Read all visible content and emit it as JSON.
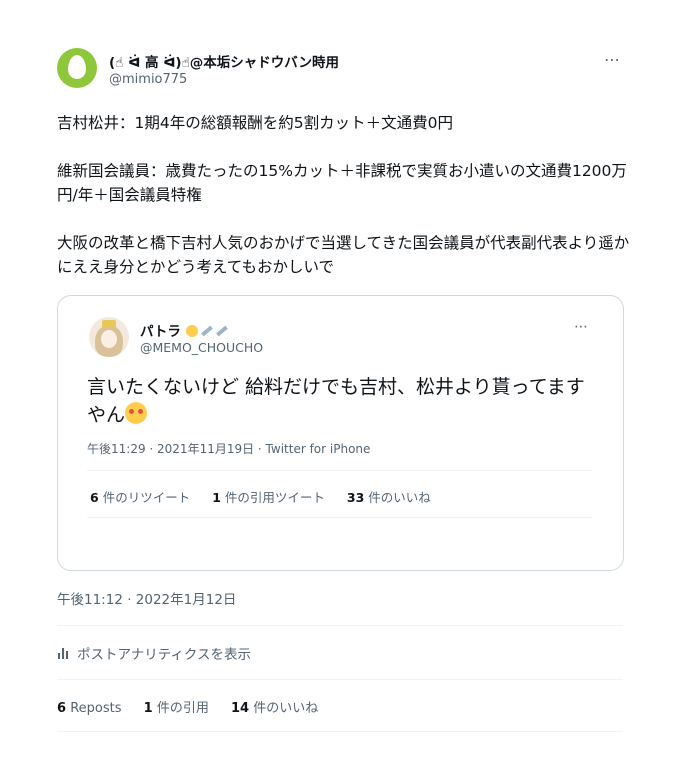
{
  "tweet": {
    "author_name": "(☝ ᐛ 高 ᐛ)☝@本垢シャドウバン時用",
    "author_handle": "@mimio775",
    "more_icon": "⋯",
    "body": "吉村松井：1期4年の総額報酬を約5割カット＋文通費0円\n\n維新国会議員：歳費たったの15%カット＋非課税で実質お小遣いの文通費1200万円/年＋国会議員特権\n\n大阪の改革と橋下吉村人気のおかげで当選してきた国会議員が代表副代表より遥かにええ身分とかどう考えてもおかしいで",
    "timestamp": "午後11:12 · 2022年1月12日",
    "analytics_label": "ポストアナリティクスを表示",
    "stats": {
      "reposts_count": "6",
      "reposts_label": "Reposts",
      "quotes_count": "1",
      "quotes_label": "件の引用",
      "likes_count": "14",
      "likes_label": "件のいいね"
    }
  },
  "quoted": {
    "author_name": "パトラ",
    "author_handle": "@MEMO_CHOUCHO",
    "more_icon": "⋯",
    "text": "言いたくないけど 給料だけでも吉村、松井より貰ってますやん",
    "meta": "午後11:29 · 2021年11月19日 · Twitter for iPhone",
    "stats": {
      "retweets_count": "6",
      "retweets_label": "件のリツイート",
      "quotes_count": "1",
      "quotes_label": "件の引用ツイート",
      "likes_count": "33",
      "likes_label": "件のいいね"
    }
  },
  "colors": {
    "secondary_text": "#536471",
    "border": "#cfd9de",
    "avatar_green": "#8fc73a"
  }
}
